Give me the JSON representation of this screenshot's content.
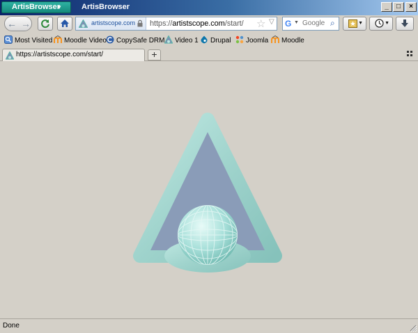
{
  "titlebar": {
    "app_menu_label": "ArtisBrowser",
    "window_title": "ArtisBrowser",
    "minimize_glyph": "_",
    "maximize_glyph": "□",
    "close_glyph": "×"
  },
  "navbar": {
    "back_icon": "back-arrow-icon",
    "forward_icon": "forward-arrow-icon",
    "reload_icon": "reload-icon",
    "home_icon": "home-icon",
    "identity_label": "artistscope.com",
    "url_prefix": "https://",
    "url_host": "artistscope.com",
    "url_path": "/start/",
    "search": {
      "engine": "Google",
      "engine_initial": "G",
      "placeholder": "Google"
    }
  },
  "bookmarks": [
    {
      "label": "Most Visited",
      "icon": "most-visited-icon"
    },
    {
      "label": "Moodle Video",
      "icon": "moodle-icon"
    },
    {
      "label": "CopySafe DRM",
      "icon": "copysafe-icon"
    },
    {
      "label": "Video 1",
      "icon": "artistscope-icon"
    },
    {
      "label": "Drupal",
      "icon": "drupal-icon"
    },
    {
      "label": "Joomla",
      "icon": "joomla-icon"
    },
    {
      "label": "Moodle",
      "icon": "moodle-icon"
    }
  ],
  "tabs": [
    {
      "label": "https://artistscope.com/start/",
      "active": true
    }
  ],
  "status": {
    "text": "Done"
  },
  "colors": {
    "titlebar_start": "#0a246a",
    "app_menu": "#1f9d8f",
    "chrome": "#d4d0c8",
    "logo_frame": "#9fd3cc",
    "logo_fill": "#8a9cb8",
    "logo_globe": "#a8e0da"
  }
}
